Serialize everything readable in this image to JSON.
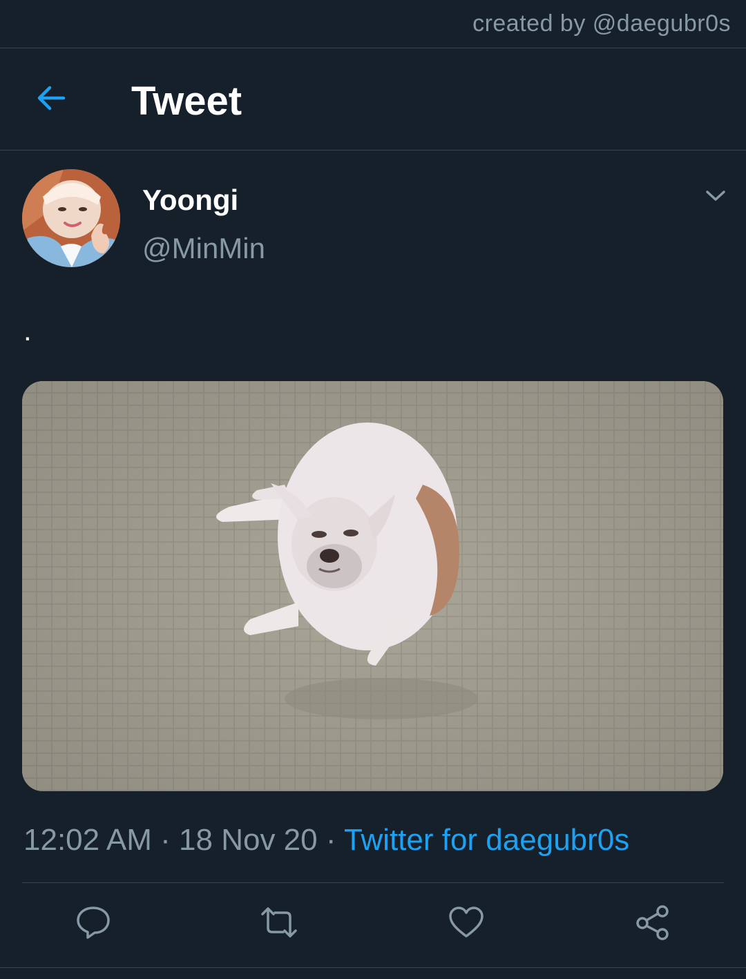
{
  "watermark": "created by @daegubr0s",
  "header": {
    "title": "Tweet",
    "back_icon": "arrow-left-icon"
  },
  "tweet": {
    "display_name": "Yoongi",
    "handle": "@MinMin",
    "text": ".",
    "time": "12:02 AM",
    "separator": "·",
    "date": "18 Nov 20",
    "source": "Twitter for daegubr0s"
  },
  "actions": [
    "reply-icon",
    "retweet-icon",
    "like-icon",
    "share-icon"
  ],
  "colors": {
    "background": "#15202b",
    "accent": "#1da1f2",
    "muted": "#8899a6",
    "border": "#38444d",
    "text": "#ffffff"
  }
}
